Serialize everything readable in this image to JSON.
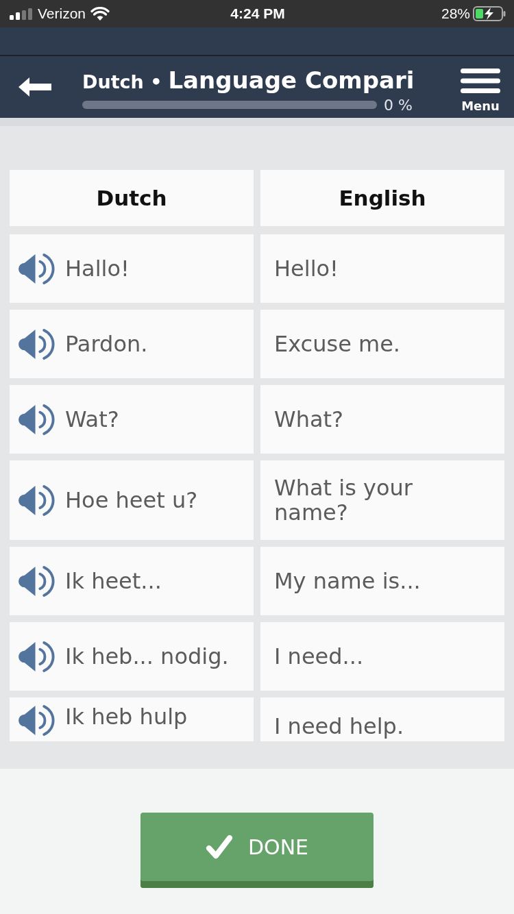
{
  "status_bar": {
    "carrier": "Verizon",
    "time": "4:24 PM",
    "battery": "28%"
  },
  "header": {
    "language": "Dutch •",
    "title": "Language Compari",
    "progress": {
      "level": 0,
      "reading": "0 %"
    },
    "menu_label": "Menu"
  },
  "table": {
    "columns": [
      "Dutch",
      "English"
    ],
    "rows": [
      {
        "cells": [
          "Hallo!",
          "Hello!"
        ]
      },
      {
        "cells": [
          "Pardon.",
          "Excuse me."
        ]
      },
      {
        "cells": [
          "Wat?",
          "What?"
        ]
      },
      {
        "cells": [
          "Hoe heet u?",
          "What is your name?"
        ]
      },
      {
        "cells": [
          "Ik heet...",
          "My name is..."
        ]
      },
      {
        "cells": [
          "Ik heb... nodig.",
          "I need..."
        ]
      },
      {
        "cells": [
          "Ik heb hulp",
          "I need help."
        ]
      }
    ]
  },
  "done_button": {
    "label": "DONE"
  }
}
